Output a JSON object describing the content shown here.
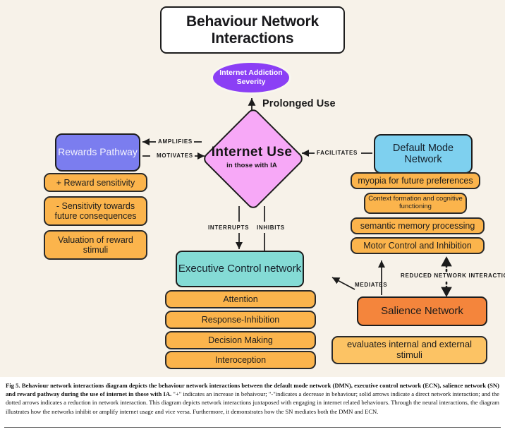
{
  "figure": {
    "title": "Behaviour Network Interactions",
    "background_color": "#f7f2e9"
  },
  "nodes": {
    "severity": {
      "label": "Internet Addiction Severity",
      "color": "#8b3ff5"
    },
    "internet_use": {
      "label": "Internet Use",
      "sublabel": "in those with IA",
      "color": "#f7a8f7"
    },
    "rewards_pathway": {
      "label": "Rewards Pathway",
      "color": "#7b7def"
    },
    "default_mode_network": {
      "label": "Default Mode Network",
      "color": "#7ed0ef"
    },
    "executive_control_network": {
      "label": "Executive Control network",
      "color": "#84dbd5"
    },
    "salience_network": {
      "label": "Salience Network",
      "color": "#f4853c"
    }
  },
  "rewards_attributes": [
    "+ Reward sensitivity",
    "- Sensitivity towards future consequences",
    "Valuation of reward stimuli"
  ],
  "dmn_attributes": [
    "myopia for future preferences",
    "Context formation and cognitive functioning",
    "semantic memory processing",
    "Motor Control and Inhibition"
  ],
  "ecn_attributes": [
    "Attention",
    "Response-Inhibition",
    "Decision Making",
    "Interoception"
  ],
  "sn_attributes": [
    "evaluates internal and external stimuli"
  ],
  "edges": {
    "prolonged_use": "Prolonged Use",
    "amplifies": "AMPLIFIES",
    "motivates": "MOTIVATES",
    "facilitates": "FACILITATES",
    "interrupts": "INTERRUPTS",
    "inhibits": "INHIBITS",
    "mediates": "MEDIATES",
    "reduced_network_interaction": "REDUCED NETWORK INTERACTION"
  },
  "caption": {
    "figure_number": "Fig 5.",
    "bold_part": "Behaviour network interactions diagram depicts the behaviour network interactions between the default mode network (DMN), executive control network (ECN), salience network (SN) and reward pathway during the use of internet in those with IA.",
    "rest": " \"+\" indicates an increase in behaivour; \"-\"indicates a decrease in behaviour; solid arrows indicate a direct network interaction; and the dotted arrows indicates a reduction in network interaction. This diagram depicts network interactions juxtaposed with engaging in internet related behaviours. Through the neural interactions, the diagram illustrates how the networks inhibit or amplify internet usage and vice versa. Furthermore, it demonstrates how the SN mediates both the DMN and ECN."
  }
}
